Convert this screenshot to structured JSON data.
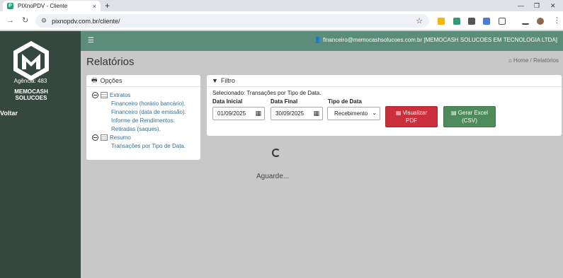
{
  "browser": {
    "tab_title": "PIXnoPDV - Cliente",
    "tab_close": "×",
    "new_tab": "+",
    "favicon_letter": "P",
    "url": "pixnopdv.com.br/cliente/"
  },
  "sidebar": {
    "agency": "Agência: 483",
    "company": "MEMOCASH SOLUCOES",
    "back_label": "Voltar"
  },
  "header": {
    "user": "financeiro@memocashsolucoes.com.br [MEMOCASH SOLUCOES EM TECNOLOGIA LTDA]"
  },
  "page": {
    "title": "Relatórios",
    "breadcrumb_home": "Home",
    "breadcrumb_sep": "/",
    "breadcrumb_current": "Relatórios"
  },
  "options": {
    "title": "Opções",
    "groups": [
      {
        "label": "Extratos",
        "items": [
          "Financeiro (horário bancário).",
          "Financeiro (data de emissão).",
          "Informe de Rendimentos.",
          "Retiradas (saques)."
        ]
      },
      {
        "label": "Resumo",
        "items": [
          "Transações por Tipo de Data."
        ]
      }
    ]
  },
  "filter": {
    "title": "Filtro",
    "selected": "Selecionado: Transações por Tipo de Data.",
    "start_label": "Data Inicial",
    "start_value": "01/09/2025",
    "end_label": "Data Final",
    "end_value": "30/09/2025",
    "type_label": "Tipo de Data",
    "type_value": "Recebimento",
    "pdf_line1": "Visualizar",
    "pdf_line2": "PDF",
    "excel_line1": "Gerar Excel",
    "excel_line2": "(CSV)"
  },
  "loading": {
    "text": "Aguarde..."
  },
  "colors": {
    "sidebar": "#35483f",
    "appbar": "#5c8c7a",
    "pdf_button": "#c9303c",
    "excel_button": "#4f8a5b"
  }
}
